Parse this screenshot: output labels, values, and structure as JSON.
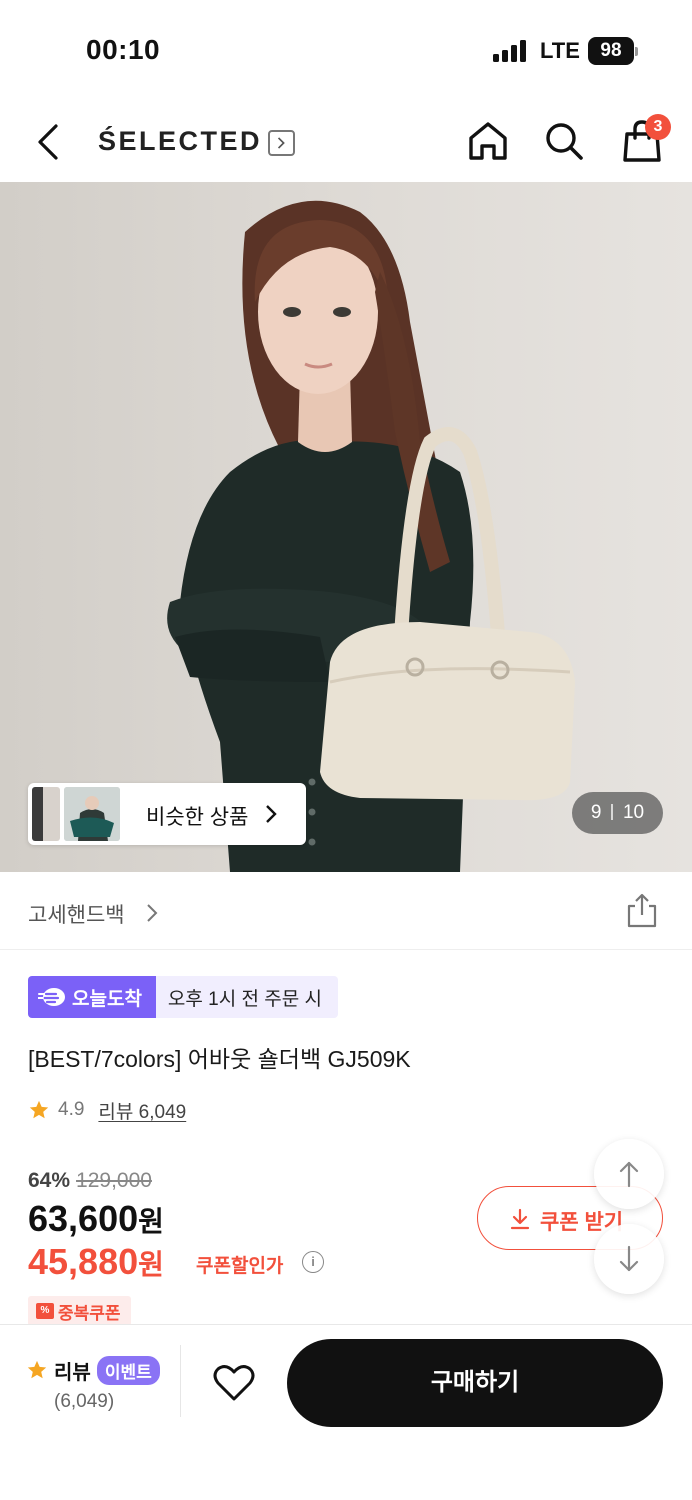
{
  "status_bar": {
    "time": "00:10",
    "network": "LTE",
    "battery": "98"
  },
  "header": {
    "brand": "ŚELECTED",
    "cart_count": "3"
  },
  "hero": {
    "similar_label": "비슷한 상품",
    "page_current": "9",
    "page_total": "10"
  },
  "category": {
    "label": "고세핸드백"
  },
  "delivery": {
    "badge": "오늘도착",
    "note": "오후 1시 전 주문 시"
  },
  "product": {
    "title": "[BEST/7colors] 어바웃 숄더백 GJ509K",
    "rating": "4.9",
    "review_link": "리뷰 6,049"
  },
  "price": {
    "discount": "64%",
    "original": "129,000",
    "sale": "63,600",
    "sale_unit": "원",
    "coupon_price": "45,880",
    "coupon_unit": "원",
    "coupon_label": "쿠폰할인가",
    "coupon_button": "쿠폰 받기",
    "duplicate_coupon": "중복쿠폰"
  },
  "bottom": {
    "review_label": "리뷰",
    "event_label": "이벤트",
    "review_count": "(6,049)",
    "buy_label": "구매하기"
  },
  "colors": {
    "accent": "#f2503c",
    "purple": "#7b61f7",
    "dark": "#111111"
  }
}
